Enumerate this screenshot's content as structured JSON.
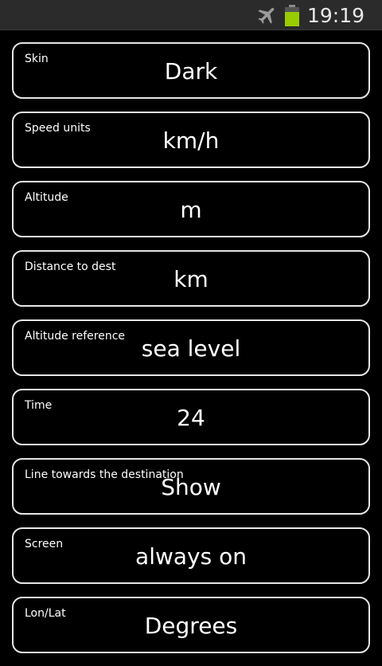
{
  "status_bar": {
    "time": "19:19",
    "battery_level": 0.75,
    "battery_color": "#99cc00",
    "icons": [
      "airplane-icon",
      "battery-icon"
    ]
  },
  "settings": [
    {
      "label": "Skin",
      "value": "Dark"
    },
    {
      "label": "Speed units",
      "value": "km/h"
    },
    {
      "label": "Altitude",
      "value": "m"
    },
    {
      "label": "Distance to dest",
      "value": "km"
    },
    {
      "label": "Altitude reference",
      "value": "sea level"
    },
    {
      "label": "Time",
      "value": "24"
    },
    {
      "label": "Line towards the destination",
      "value": "Show"
    },
    {
      "label": "Screen",
      "value": "always on"
    },
    {
      "label": "Lon/Lat",
      "value": "Degrees"
    }
  ]
}
